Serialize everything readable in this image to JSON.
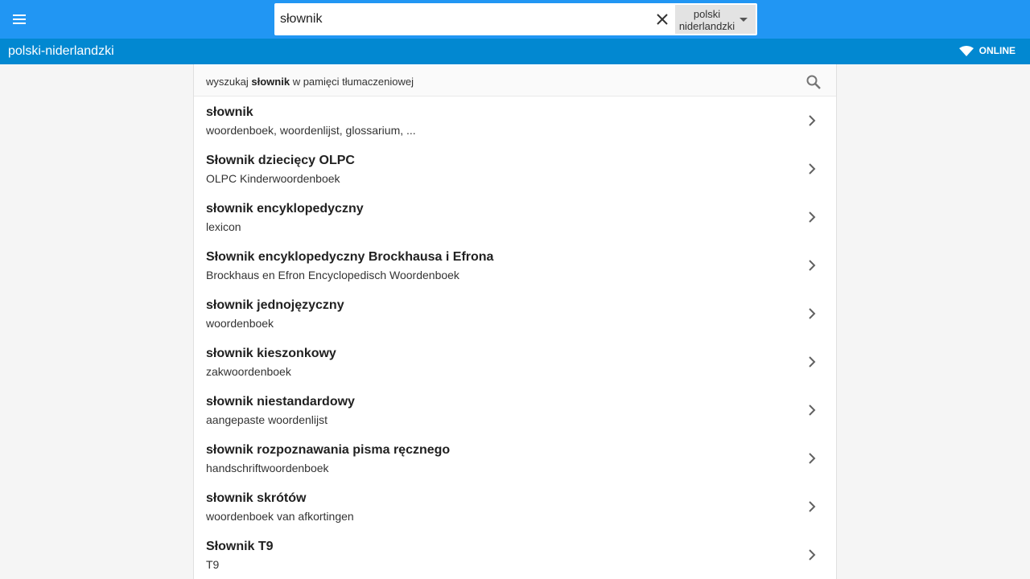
{
  "header": {
    "menu_icon": "menu-icon",
    "search": {
      "value": "słownik",
      "clear_icon": "close-icon"
    },
    "language": {
      "line1": "polski",
      "line2": "niderlandzki",
      "icon": "dropdown-arrow-icon"
    },
    "color": "#2196f3"
  },
  "subheader": {
    "title": "polski-niderlandzki",
    "status": "ONLINE",
    "status_icon": "wifi-icon",
    "color": "#0288d1"
  },
  "tm_search": {
    "prefix": "wyszukaj",
    "term": "słownik",
    "suffix": "w pamięci tłumaczeniowej",
    "icon": "search-icon"
  },
  "results": [
    {
      "title": "słownik",
      "translation": "woordenboek, woordenlijst, glossarium, ..."
    },
    {
      "title": "Słownik dziecięcy OLPC",
      "translation": "OLPC Kinderwoordenboek"
    },
    {
      "title": "słownik encyklopedyczny",
      "translation": "lexicon"
    },
    {
      "title": "Słownik encyklopedyczny Brockhausa i Efrona",
      "translation": "Brockhaus en Efron Encyclopedisch Woordenboek"
    },
    {
      "title": "słownik jednojęzyczny",
      "translation": "woordenboek"
    },
    {
      "title": "słownik kieszonkowy",
      "translation": "zakwoordenboek"
    },
    {
      "title": "słownik niestandardowy",
      "translation": "aangepaste woordenlijst"
    },
    {
      "title": "słownik rozpoznawania pisma ręcznego",
      "translation": "handschriftwoordenboek"
    },
    {
      "title": "słownik skrótów",
      "translation": "woordenboek van afkortingen"
    },
    {
      "title": "Słownik T9",
      "translation": "T9"
    }
  ]
}
